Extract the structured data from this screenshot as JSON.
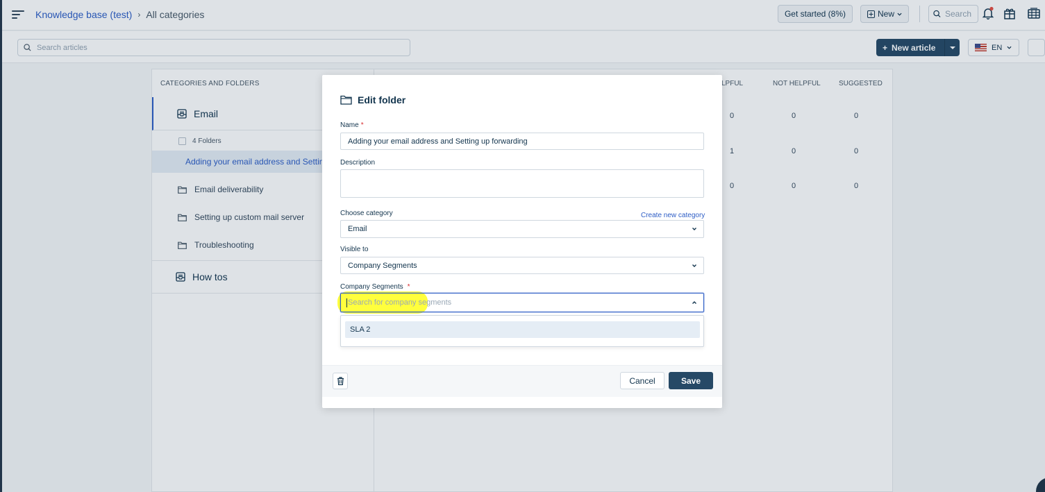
{
  "breadcrumb": {
    "root": "Knowledge base (test)",
    "separator": "›",
    "current": "All categories"
  },
  "topbar": {
    "get_started": "Get started (8%)",
    "new_label": "New",
    "search_label": "Search",
    "notification_dot_color": "#e54d42"
  },
  "subbar": {
    "search_placeholder": "Search articles",
    "new_article": "New article",
    "language": "EN"
  },
  "table": {
    "left_header": "CATEGORIES AND FOLDERS",
    "right_headers": [
      "HELPFUL",
      "NOT HELPFUL",
      "SUGGESTED"
    ],
    "right_header_visible_part": "LPFUL",
    "rows": [
      [
        "0",
        "0",
        "0"
      ],
      [
        "1",
        "0",
        "0"
      ],
      [
        "0",
        "0",
        "0"
      ]
    ]
  },
  "categories": [
    {
      "name": "Email",
      "folders_count": "4 Folders",
      "folders": [
        "Adding your email address and Setting up forwarding",
        "Email deliverability",
        "Setting up custom mail server",
        "Troubleshooting"
      ]
    },
    {
      "name": "How tos"
    }
  ],
  "modal": {
    "title": "Edit folder",
    "name_label": "Name",
    "name_value": "Adding your email address and Setting up forwarding",
    "description_label": "Description",
    "description_value": "",
    "category_label": "Choose category",
    "create_category_link": "Create new category",
    "category_value": "Email",
    "visible_label": "Visible to",
    "visible_value": "Company Segments",
    "segments_label": "Company Segments",
    "segments_placeholder": "Search for company segments",
    "segment_options": [
      "SLA 2"
    ],
    "cancel": "Cancel",
    "save": "Save"
  },
  "colors": {
    "accent": "#2c5cc5",
    "primary_button": "#264966",
    "highlight": "#ffff33",
    "required": "#d72d30"
  }
}
